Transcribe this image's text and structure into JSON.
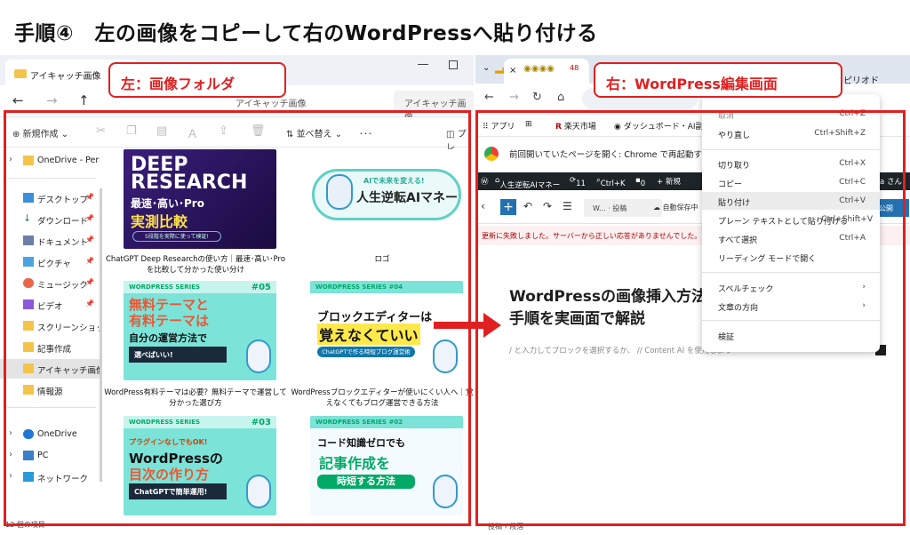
{
  "header": {
    "title": "手順④　左の画像をコピーして右のWordPressへ貼り付ける"
  },
  "labels": {
    "left": "左：画像フォルダ",
    "right": "右：WordPress編集画面"
  },
  "explorer": {
    "tab_title": "アイキャッチ画像",
    "address": "アイキャッチ画像",
    "search_placeholder": "アイキャッチ画像",
    "toolbar": {
      "new": "新規作成",
      "sort": "並べ替え",
      "more": "･･･",
      "preview": "プレ"
    },
    "sidebar": [
      {
        "label": "OneDrive - Pers",
        "icon": "folder-icon"
      },
      {
        "label": "デスクトップ",
        "icon": "desktop-icon"
      },
      {
        "label": "ダウンロード",
        "icon": "download-icon"
      },
      {
        "label": "ドキュメント",
        "icon": "document-icon"
      },
      {
        "label": "ピクチャ",
        "icon": "picture-icon"
      },
      {
        "label": "ミュージック",
        "icon": "music-icon"
      },
      {
        "label": "ビデオ",
        "icon": "video-icon"
      },
      {
        "label": "スクリーンショット",
        "icon": "folder-icon"
      },
      {
        "label": "記事作成",
        "icon": "folder-icon"
      },
      {
        "label": "アイキャッチ画像",
        "icon": "folder-icon"
      },
      {
        "label": "情報源",
        "icon": "folder-icon"
      },
      {
        "label": "OneDrive",
        "icon": "cloud-icon"
      },
      {
        "label": "PC",
        "icon": "pc-icon"
      },
      {
        "label": "ネットワーク",
        "icon": "network-icon"
      }
    ],
    "files": [
      {
        "caption": "ChatGPT Deep Researchの使い方｜最速･高い･Proを比較して分かった使い分け",
        "thumb": {
          "l1": "DEEP",
          "l1b": "RESEARCH",
          "l2": "最速･高い･Pro",
          "l3": "実測比較",
          "pill": "5段階を実際に使って検証!"
        }
      },
      {
        "caption": "ロゴ",
        "thumb": {
          "l1": "AIで未来を変える!",
          "l2": "人生逆転AIマネー"
        }
      },
      {
        "caption": "WordPress有料テーマは必要？無料テーマで運営して分かった選び方",
        "thumb": {
          "hd": "WORDPRESS SERIES",
          "n": "#05",
          "m1": "無料テーマと",
          "m2": "有料テーマは",
          "m3": "自分の運営方法で",
          "band": "選べばいい!"
        }
      },
      {
        "caption": "WordPressブロックエディターが使いにくい人へ｜覚えなくてもブログ運営できる方法",
        "thumb": {
          "hd": "WORDPRESS SERIES #04",
          "m": "ブロックエディターは",
          "m2": "覚えなくていい",
          "pl": "ChatGPTで作る時短ブログ運営術"
        }
      },
      {
        "caption": "",
        "thumb": {
          "hd": "WORDPRESS SERIES",
          "n": "#03",
          "m1": "プラグインなしでもOK!",
          "m2": "WordPressの",
          "m3": "目次の作り方",
          "band": "ChatGPTで簡単運用!"
        }
      },
      {
        "caption": "",
        "thumb": {
          "hd": "WORDPRESS SERIES #02",
          "m": "コード知識ゼロでも",
          "m2": "記事作成を",
          "pl": "時短する方法"
        }
      }
    ],
    "status": "12 個の項目"
  },
  "browser": {
    "tab_badge": "48",
    "bookmarks": {
      "apps": "アプリ",
      "rakuten": "楽天市場",
      "dashboard": "ダッシュボード・AI副業..."
    },
    "profile_hint": "ピリオド",
    "restore_text": "前回開いていたページを開く: Chrome で再起動するたびに",
    "wpbar": {
      "site": "人生逆転AIマネー",
      "comments": "11",
      "ctrlk": "Ctrl+K",
      "zero": "0",
      "new": "+ 新規",
      "user": "ya さん"
    },
    "editor": {
      "title_chip": "W... · 投稿",
      "autosave": "自動保存中",
      "publish": "公開"
    },
    "error": "更新に失敗しました。サーバーから正しい応答がありませんでした。",
    "post_title_1": "WordPressの画像挿入方法",
    "post_title_2": "手順を実画面で解説",
    "placeholder": "/ と入力してブロックを選択するか、 // Content AI を使用しよう",
    "footer": "投稿 › 段落"
  },
  "context_menu": [
    {
      "label": "取消",
      "shortcut": "Ctrl+Z"
    },
    {
      "label": "やり直し",
      "shortcut": "Ctrl+Shift+Z"
    },
    {
      "label": "切り取り",
      "shortcut": "Ctrl+X"
    },
    {
      "label": "コピー",
      "shortcut": "Ctrl+C"
    },
    {
      "label": "貼り付け",
      "shortcut": "Ctrl+V"
    },
    {
      "label": "プレーン テキストとして貼り付ける",
      "shortcut": "Ctrl+Shift+V"
    },
    {
      "label": "すべて選択",
      "shortcut": "Ctrl+A"
    },
    {
      "label": "リーディング モードで開く",
      "shortcut": ""
    },
    {
      "label": "スペルチェック",
      "shortcut": "›"
    },
    {
      "label": "文章の方向",
      "shortcut": "›"
    },
    {
      "label": "検証",
      "shortcut": ""
    }
  ],
  "colors": {
    "accent_red": "#e02020",
    "wp_blue": "#2271b1",
    "wp_bar": "#1d2327"
  }
}
